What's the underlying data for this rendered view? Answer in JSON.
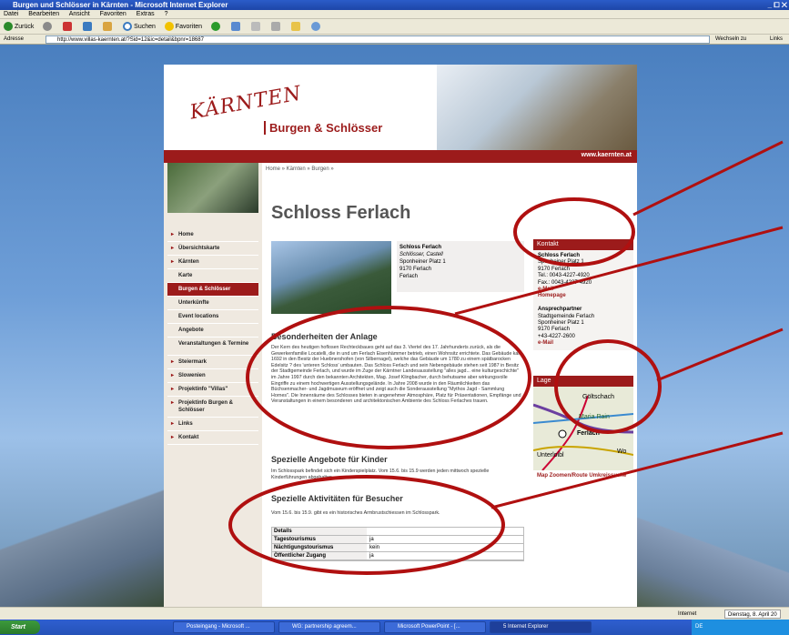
{
  "window": {
    "title": "Burgen und Schlösser in Kärnten - Microsoft Internet Explorer",
    "controls": "_ ⧠ ✕"
  },
  "menu": [
    "Datei",
    "Bearbeiten",
    "Ansicht",
    "Favoriten",
    "Extras",
    "?"
  ],
  "toolbar": {
    "back": "Zurück",
    "search": "Suchen",
    "favorites": "Favoriten"
  },
  "address": {
    "label": "Adresse",
    "url": "http://www.villas-kaernten.at/?Sid=12&ic=detail&bpnr=18687",
    "go": "Wechseln zu",
    "links": "Links"
  },
  "site": {
    "logo": "KÄRNTEN",
    "subtitle": "Burgen & Schlösser",
    "url_text": "www.kaernten.at",
    "breadcrumb": "Home » Kärnten » Burgen »"
  },
  "nav": [
    {
      "label": "Home",
      "top": true
    },
    {
      "label": "Übersichtskarte",
      "top": true
    },
    {
      "label": "Kärnten",
      "top": true
    },
    {
      "label": "Karte",
      "top": false
    },
    {
      "label": "Burgen & Schlösser",
      "top": false,
      "active": true
    },
    {
      "label": "Unterkünfte",
      "top": false
    },
    {
      "label": "Event locations",
      "top": false
    },
    {
      "label": "Angebote",
      "top": false
    },
    {
      "label": "Veranstaltungen & Termine",
      "top": false
    },
    {
      "label": "Steiermark",
      "top": true
    },
    {
      "label": "Slowenien",
      "top": true
    },
    {
      "label": "Projektinfo \"Villas\"",
      "top": true
    },
    {
      "label": "Projektinfo Burgen & Schlösser",
      "top": true
    },
    {
      "label": "Links",
      "top": true
    },
    {
      "label": "Kontakt",
      "top": true
    }
  ],
  "main": {
    "title": "Schloss Ferlach",
    "info": {
      "name": "Schloss Ferlach",
      "line2": "Schlösser, Castell",
      "street": "Sponheiner Platz 1",
      "zip": "9170 Ferlach",
      "town": "Ferlach"
    },
    "h_features": "Besonderheiten der Anlage",
    "p_features": "Der Kern des heutigen hoflosen Rechteckbaues geht auf das 3. Viertel des 17. Jahrhunderts zurück, als die Gewerkenfamilie Locatelli, die in und um Ferlach Eisenhämmer betrieb, einen Wohnsitz errichtete. Das Gebäude kam 1692 in den Besitz der Huebnershofen (von Silbernagel), welche das Gebäude um 1780 zu einem spätbarocken Edelsitz ? des 'unteren Schloss' umbauten. Das Schloss Ferlach und sein Nebengebäude stehen seit 1987 in Besitz der Stadtgemeinde Ferlach, und wurde im Zuge der Kärntner Landesausstellung \"alles jagd... eine kulturgeschichte\" im Jahre 1997 durch den bekannten Architekten, Mag. Josef Klingbacher, durch behutsame aber wirkungsvolle Eingriffe zu einem hochwertigen Ausstellungsgelände. In Jahre 2008 wurde in den Räumlichkeiten das Büchsenmacher- und Jagdmuseum eröffnet und zeigt auch die Sonderausstellung \"Mythos Jagd - Sammlung Hornes\". Die Innenräume des Schlosses bieten in angenehmer Atmosphäre, Platz für Präsentationen, Empfänge und Veranstaltungen in einem besonderen und architektonischen Ambiente des Schloss Ferlaches trauen.",
    "h_kids": "Spezielle Angebote für Kinder",
    "p_kids": "Im Schlosspark befindet sich ein Kinderspielplatz. Vom 15.6. bis 15.9 werden jeden mittwoch spezielle Kinderführungen abgehalten.",
    "h_visitors": "Spezielle Aktivitäten für Besucher",
    "p_visitors": "Vom 15.6. bis 15.9. gibt es ein historisches Armbrustschiessen im Schlosspark.",
    "table_label": "Details",
    "table": [
      {
        "k": "Tagestourismus",
        "v": "ja"
      },
      {
        "k": "Nächtigungstourismus",
        "v": "kein"
      },
      {
        "k": "Öffentlicher Zugang",
        "v": "ja"
      }
    ]
  },
  "kontakt": {
    "head": "Kontakt",
    "name": "Schloss Ferlach",
    "street": "Sponheiner Platz 1",
    "zip": "9170 Ferlach",
    "tel": "Tel.: 0043-4227-4920",
    "fax": "Fax.: 0043-4227-4920",
    "email": "e-Mail",
    "homepage": "Homepage",
    "contact_head": "Ansprechpartner",
    "contact_org": "Stadtgemeinde Ferlach",
    "contact_street": "Sponheiner Platz 1",
    "contact_zip": "9170 Ferlach",
    "contact_tel": "+43-4227-2600",
    "contact_email": "e-Mail"
  },
  "lage": {
    "head": "Lage",
    "labels": [
      "Göltschach",
      "Maria Rain",
      "Ferlach",
      "Unterloibl",
      "Wo"
    ],
    "link": "Map Zoomen/Route Umkreissuche"
  },
  "status": {
    "zone": "Internet",
    "date": "Dienstag, 8. April 20"
  },
  "taskbar": {
    "start": "Start",
    "buttons": [
      "Posteingang - Microsoft ...",
      "WG: partnership agreem...",
      "Microsoft PowerPoint - [...",
      "5 Internet Explorer"
    ],
    "tray": "DE"
  },
  "colors": {
    "brand_red": "#9c1b1b",
    "annotation": "#b01010"
  }
}
